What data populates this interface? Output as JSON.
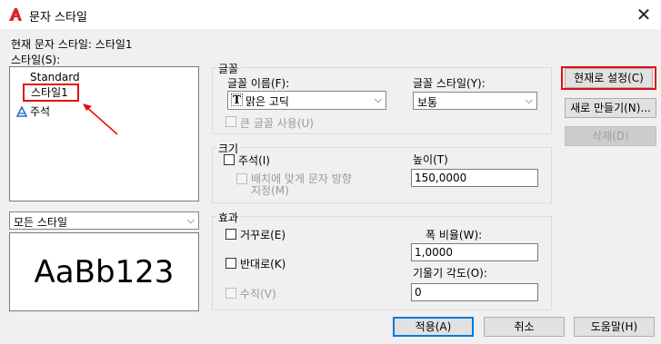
{
  "window": {
    "title": "문자 스타일",
    "close_glyph": "✕"
  },
  "current_style": {
    "label": "현재 문자 스타일:",
    "value": "스타일1"
  },
  "styles_label": "스타일(S):",
  "styles_list": {
    "items": [
      "Standard",
      "스타일1",
      "주석"
    ]
  },
  "filter_select": {
    "value": "모든 스타일"
  },
  "preview": {
    "text": "AaBb123"
  },
  "font_group": {
    "title": "글꼴",
    "font_name_label": "글꼴 이름(F):",
    "font_name_value": "맑은 고딕",
    "font_icon_glyph": "T",
    "font_style_label": "글꼴 스타일(Y):",
    "font_style_value": "보통",
    "big_font_label": "큰 글꼴 사용(U)"
  },
  "size_group": {
    "title": "크기",
    "annotative_label": "주석(I)",
    "match_orientation_label_1": "배치에 맞게 문자 방향",
    "match_orientation_label_2": "지정(M)",
    "height_label": "높이(T)",
    "height_value": "150,0000"
  },
  "effects_group": {
    "title": "효과",
    "upside_down_label": "거꾸로(E)",
    "backwards_label": "반대로(K)",
    "vertical_label": "수직(V)",
    "width_factor_label": "폭 비율(W):",
    "width_factor_value": "1,0000",
    "oblique_label": "기울기 각도(O):",
    "oblique_value": "0"
  },
  "buttons": {
    "set_current": "현재로 설정(C)",
    "new": "새로 만들기(N)...",
    "delete": "삭제(D)",
    "apply": "적용(A)",
    "cancel": "취소",
    "help": "도움말(H)"
  },
  "colors": {
    "highlight_red": "#e01010",
    "accent_blue": "#0078d7"
  }
}
